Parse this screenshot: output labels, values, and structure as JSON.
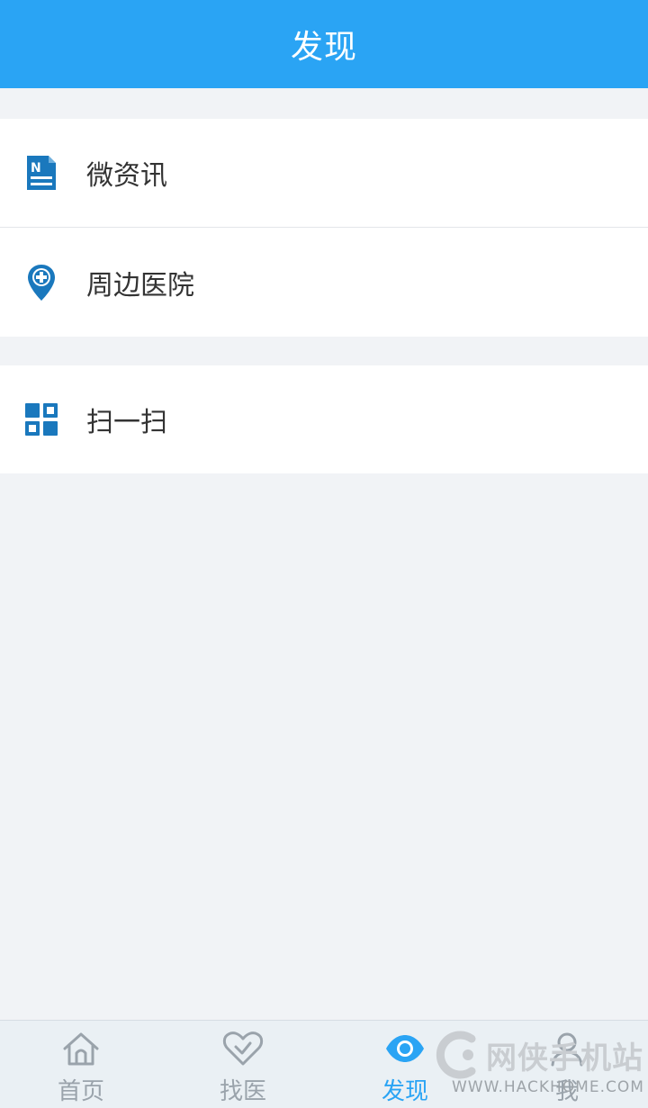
{
  "header": {
    "title": "发现"
  },
  "menu": {
    "groups": [
      [
        {
          "label": "微资讯",
          "icon": "news-icon"
        },
        {
          "label": "周边医院",
          "icon": "hospital-location-icon"
        }
      ],
      [
        {
          "label": "扫一扫",
          "icon": "qr-scan-icon"
        }
      ]
    ]
  },
  "tabbar": {
    "tabs": [
      {
        "label": "首页",
        "icon": "home-icon",
        "active": false
      },
      {
        "label": "找医",
        "icon": "heart-icon",
        "active": false
      },
      {
        "label": "发现",
        "icon": "eye-icon",
        "active": true
      },
      {
        "label": "我",
        "icon": "user-icon",
        "active": false
      }
    ]
  },
  "watermark": {
    "text_cn": "网侠手机站",
    "text_en": "WWW.HACKHOME.COM"
  },
  "colors": {
    "accent": "#2aa4f4",
    "icon_blue": "#1a78bd",
    "background": "#f1f3f6",
    "tab_inactive": "#9aa3ab"
  }
}
